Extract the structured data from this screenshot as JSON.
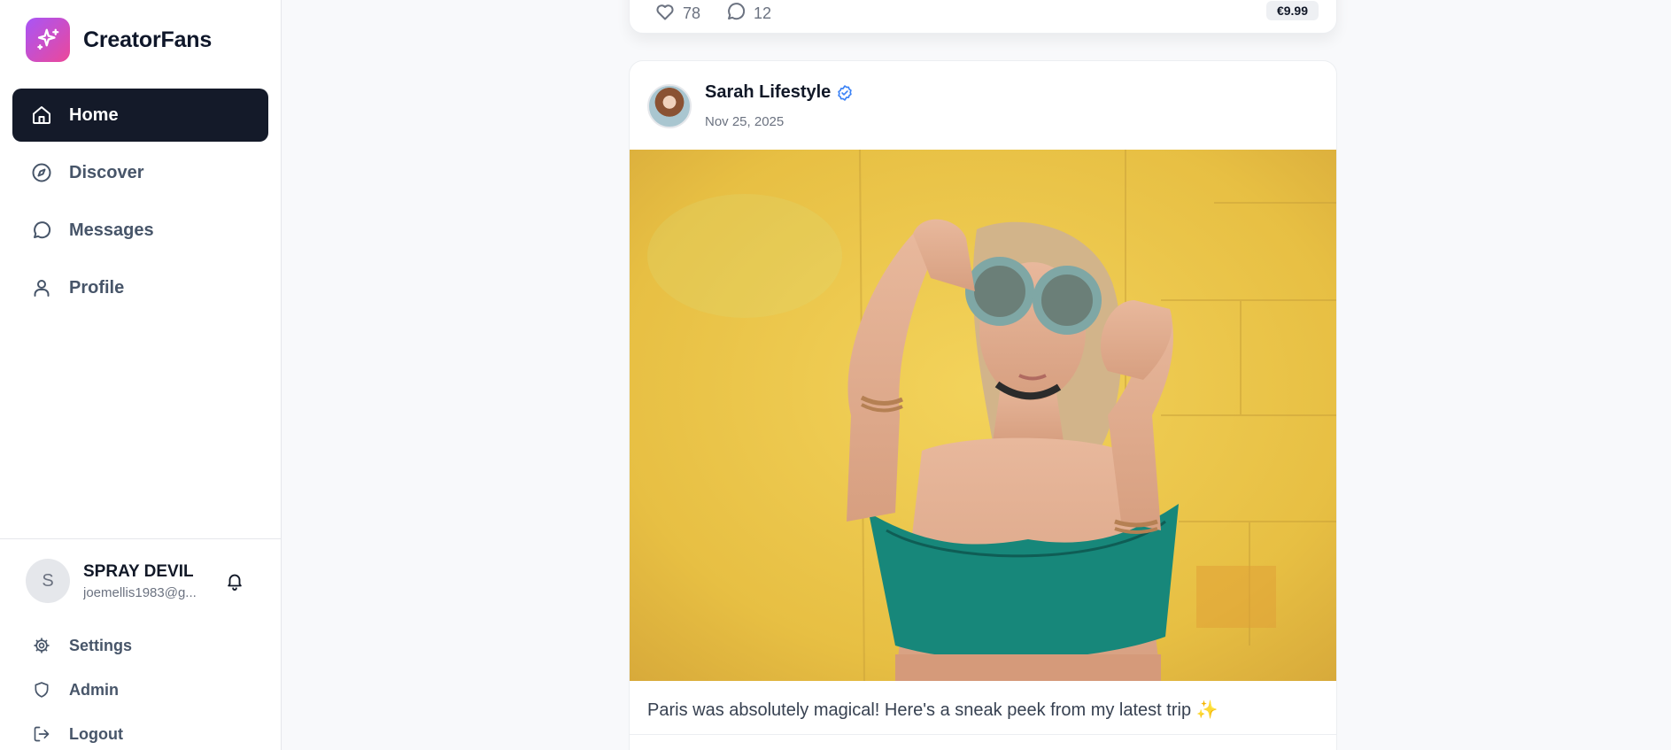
{
  "brand": {
    "name": "CreatorFans",
    "logo_icon": "sparkles-icon",
    "accent_from": "#a855f7",
    "accent_to": "#ec4899"
  },
  "nav": {
    "items": [
      {
        "label": "Home",
        "icon": "home-icon",
        "active": true
      },
      {
        "label": "Discover",
        "icon": "compass-icon",
        "active": false
      },
      {
        "label": "Messages",
        "icon": "message-circle-icon",
        "active": false
      },
      {
        "label": "Profile",
        "icon": "user-icon",
        "active": false
      }
    ]
  },
  "user": {
    "initial": "S",
    "name": "SPRAY DEVIL",
    "email": "joemellis1983@g..."
  },
  "footer": {
    "links": [
      {
        "label": "Settings",
        "icon": "gear-icon"
      },
      {
        "label": "Admin",
        "icon": "shield-icon"
      },
      {
        "label": "Logout",
        "icon": "logout-icon"
      }
    ]
  },
  "feed": {
    "previous_post": {
      "likes": "78",
      "comments": "12",
      "price": "€9.99"
    },
    "post": {
      "author": "Sarah Lifestyle",
      "verified": true,
      "date": "Nov 25, 2025",
      "caption": "Paris was absolutely magical! Here's a sneak peek from my latest trip ✨"
    }
  },
  "colors": {
    "active_nav_bg": "#141a29",
    "verified": "#3b82f6",
    "page_bg": "#f8f9fb"
  }
}
